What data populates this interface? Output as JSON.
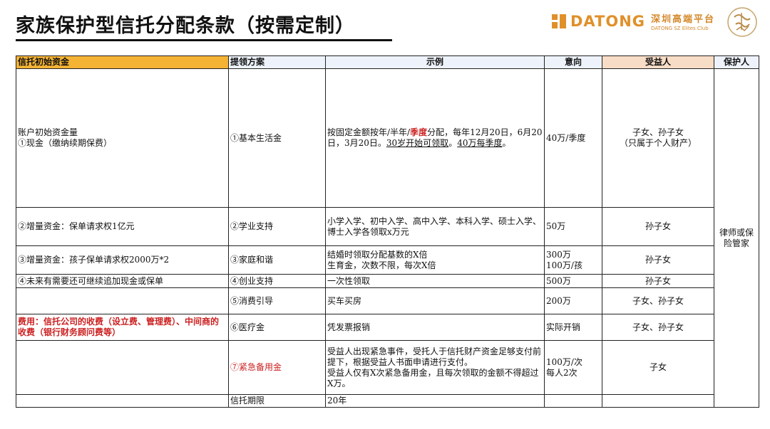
{
  "header": {
    "title": "家族保护型信托分配条款（按需定制）",
    "brand_name": "DATONG",
    "brand_cn": "深圳高端平台",
    "brand_en": "DATONG SZ Elites Club",
    "seal_text": "超 沃 帝 八 山",
    "colors": {
      "brand": "#e0902a",
      "header_asset": "#f5b335",
      "header_benef": "#f7dcc6",
      "accent_red": "#cc1f1f"
    }
  },
  "table": {
    "headers": {
      "asset": "信托初始资金",
      "plan": "提领方案",
      "example": "示例",
      "intent": "意向",
      "beneficiary": "受益人",
      "protector": "保护人"
    },
    "rows": [
      {
        "asset_line1": "账户初始资金量",
        "asset_line2": "①现金（缴纳续期保费）",
        "plan": "①基本生活金",
        "example_p1": "按固定金额按年/半年/",
        "example_hl": "季度",
        "example_p2": "分配，每年12月20日，6月20日，3月20日。",
        "example_ul1": "30岁开始可领取",
        "example_p3": "。",
        "example_ul2": "40万每季度",
        "example_p4": "。",
        "intent": "40万/季度",
        "beneficiary_line1": "子女、孙子女",
        "beneficiary_line2": "（只属于个人财产）"
      },
      {
        "asset": "②增量资金：保单请求权1亿元",
        "plan": "②学业支持",
        "example": "小学入学、初中入学、高中入学、本科入学、硕士入学、博士入学各领取x万元",
        "intent": "50万",
        "beneficiary": "孙子女"
      },
      {
        "asset": "③增量资金：孩子保单请求权2000万*2",
        "plan": "③家庭和谐",
        "example_line1": "结婚时领取分配基数的X倍",
        "example_line2": "生育金，次数不限，每次X倍",
        "intent_line1": "300万",
        "intent_line2": "100万/孩",
        "beneficiary": "孙子女"
      },
      {
        "asset": "④未来有需要还可继续追加现金或保单",
        "plan": "④创业支持",
        "example": "一次性领取",
        "intent": "500万",
        "beneficiary": "孙子女"
      },
      {
        "asset": "",
        "plan": "⑤消费引导",
        "example": "买车买房",
        "intent": "200万",
        "beneficiary": "子女、孙子女"
      },
      {
        "asset": "费用：信托公司的收费（设立费、管理费）、中间商的收费（银行财务顾问费等）",
        "plan": "⑥医疗金",
        "example": "凭发票报销",
        "intent": "实际开销",
        "beneficiary": "子女、孙子女"
      },
      {
        "asset": "",
        "plan": "⑦紧急备用金",
        "example_line1": "受益人出现紧急事件，受托人于信托财产资金足够支付前提下，根据受益人书面申请进行支付。",
        "example_line2": "受益人仅有X次紧急备用金，且每次领取的金额不得超过X万。",
        "intent_line1": "100万/次",
        "intent_line2": "每人2次",
        "beneficiary": "子女"
      },
      {
        "asset": "",
        "plan": "信托期限",
        "example": "20年",
        "intent": "",
        "beneficiary": ""
      }
    ],
    "protector": "律师或保险管家"
  }
}
